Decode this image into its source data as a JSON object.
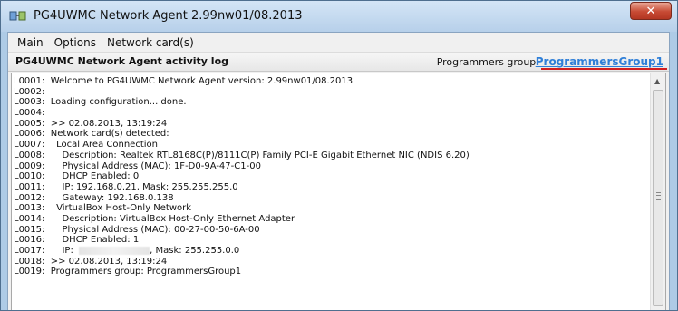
{
  "window": {
    "title": "PG4UWMC Network Agent 2.99nw01/08.2013",
    "close_label": "✕"
  },
  "menu": [
    "Main",
    "Options",
    "Network card(s)"
  ],
  "header": {
    "log_title": "PG4UWMC Network Agent activity log",
    "group_label": "Programmers group:",
    "group_link": "ProgrammersGroup1"
  },
  "log": [
    "L0001:  Welcome to PG4UWMC Network Agent version: 2.99nw01/08.2013",
    "L0002:",
    "L0003:  Loading configuration... done.",
    "L0004:",
    "L0005:  >> 02.08.2013, 13:19:24",
    "L0006:  Network card(s) detected:",
    "L0007:    Local Area Connection",
    "L0008:      Description: Realtek RTL8168C(P)/8111C(P) Family PCI-E Gigabit Ethernet NIC (NDIS 6.20)",
    "L0009:      Physical Address (MAC): 1F-D0-9A-47-C1-00",
    "L0010:      DHCP Enabled: 0",
    "L0011:      IP: 192.168.0.21, Mask: 255.255.255.0",
    "L0012:      Gateway: 192.168.0.138",
    "L0013:    VirtualBox Host-Only Network",
    "L0014:      Description: VirtualBox Host-Only Ethernet Adapter",
    "L0015:      Physical Address (MAC): 00-27-00-50-6A-00",
    "L0016:      DHCP Enabled: 1",
    "L0017:      IP:",
    "L0018:  >> 02.08.2013, 13:19:24",
    "L0019:  Programmers group: ProgrammersGroup1"
  ],
  "log_line17_suffix": ", Mask: 255.255.0.0",
  "icons": {
    "app": "network-agent-icon",
    "close": "close-icon",
    "scroll_up": "scroll-up-arrow-icon"
  },
  "colors": {
    "link": "#2f7fd8",
    "highlight_underline": "#d21f1f",
    "close_button": "#c74a34"
  }
}
